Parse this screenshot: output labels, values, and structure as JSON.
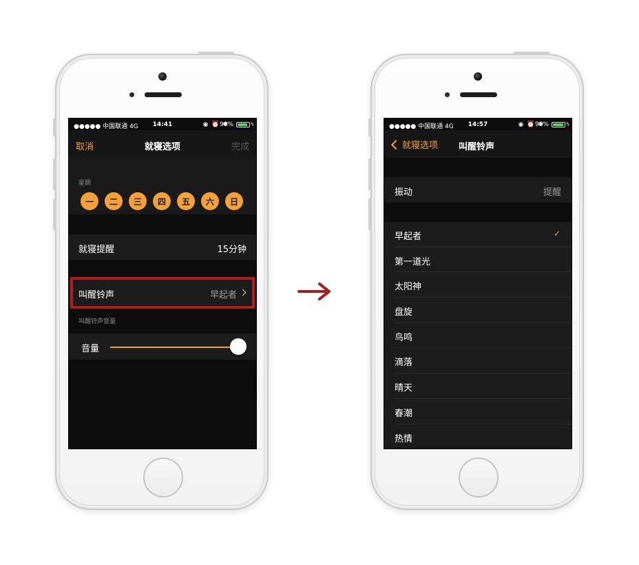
{
  "left_phone": {
    "status": {
      "carrier": "●●●●● 中国联通  4G",
      "time": "14:41",
      "icons": "◉ ⏰ ✱",
      "battery_pct": "90%",
      "battery_level": 0.9
    },
    "nav": {
      "cancel_label": "取消",
      "title": "就寝选项",
      "done_label": "完成"
    },
    "weekday_section_label": "星期",
    "weekdays": [
      "一",
      "二",
      "三",
      "四",
      "五",
      "六",
      "日"
    ],
    "bedtime_reminder": {
      "label": "就寝提醒",
      "value": "15分钟"
    },
    "wake_tone": {
      "label": "叫醒铃声",
      "value": "早起者"
    },
    "volume_section_label": "叫醒铃声音量",
    "volume": {
      "label": "音量",
      "level": 1.0
    }
  },
  "right_phone": {
    "status": {
      "carrier": "●●●●● 中国联通  4G",
      "time": "14:57",
      "icons": "◉ ⏰ ✱",
      "battery_pct": "96%",
      "battery_level": 0.96
    },
    "nav": {
      "back_label": "就寝选项",
      "title": "叫醒铃声"
    },
    "vibration": {
      "label": "振动",
      "value": "提醒"
    },
    "tones": [
      "早起者",
      "第一道光",
      "太阳神",
      "盘旋",
      "鸟鸣",
      "滴落",
      "晴天",
      "春潮",
      "热情"
    ],
    "selected_tone_index": 0,
    "check_glyph": "✓"
  },
  "colors": {
    "accent": "#f5a13a",
    "highlight_border": "#b21e1e",
    "arrow": "#a81d1d"
  }
}
